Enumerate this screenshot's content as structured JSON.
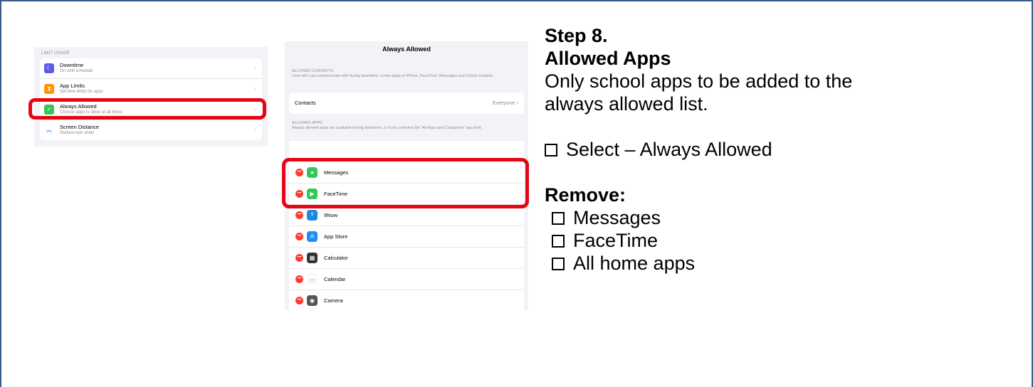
{
  "limit_usage": {
    "header": "LIMIT USAGE",
    "items": [
      {
        "title": "Downtime",
        "subtitle": "On until schedule",
        "icon": "moon-icon",
        "color": "#5e5ce6"
      },
      {
        "title": "App Limits",
        "subtitle": "Set time limits for apps",
        "icon": "hourglass-icon",
        "color": "#ff9500"
      },
      {
        "title": "Always Allowed",
        "subtitle": "Choose apps to allow at all times",
        "icon": "check-shield-icon",
        "color": "#34c759"
      },
      {
        "title": "Screen Distance",
        "subtitle": "Reduce eye strain",
        "icon": "chevrons-up-icon",
        "color": "#007aff"
      }
    ]
  },
  "always_allowed": {
    "title": "Always Allowed",
    "contacts_header": "ALLOWED CONTACTS",
    "contacts_desc": "Limit who      can communicate with during downtime. Limits apply to Phone, FaceTime, Messages and iCloud contacts.",
    "contacts_label": "Contacts",
    "contacts_value": "Everyone",
    "apps_header": "ALLOWED APPS",
    "apps_desc": "Always allowed apps are available during downtime, or if you selected the \"All Apps and Categories\" app limit.",
    "apps": [
      {
        "name": "Messages",
        "icon": "messages-icon",
        "color": "#34c759"
      },
      {
        "name": "FaceTime",
        "icon": "facetime-icon",
        "color": "#34c759"
      },
      {
        "name": "9Now",
        "icon": "9now-icon",
        "color": "#1e88e5"
      },
      {
        "name": "App Store",
        "icon": "app-store-icon",
        "color": "#1c8ef9"
      },
      {
        "name": "Calculator",
        "icon": "calculator-icon",
        "color": "#333333"
      },
      {
        "name": "Calendar",
        "icon": "calendar-icon",
        "color": "#ff3b30"
      },
      {
        "name": "Camera",
        "icon": "camera-icon",
        "color": "#555555"
      }
    ]
  },
  "instructions": {
    "step": "Step 8.",
    "heading": "Allowed Apps",
    "desc_line1": "Only school apps to be added to the",
    "desc_line2": "always allowed list.",
    "select": "Select – Always Allowed",
    "remove_heading": "Remove:",
    "remove_items": [
      "Messages",
      "FaceTime",
      "All home apps"
    ]
  },
  "colors": {
    "highlight": "#e30613",
    "frame": "#3a5a8c"
  }
}
